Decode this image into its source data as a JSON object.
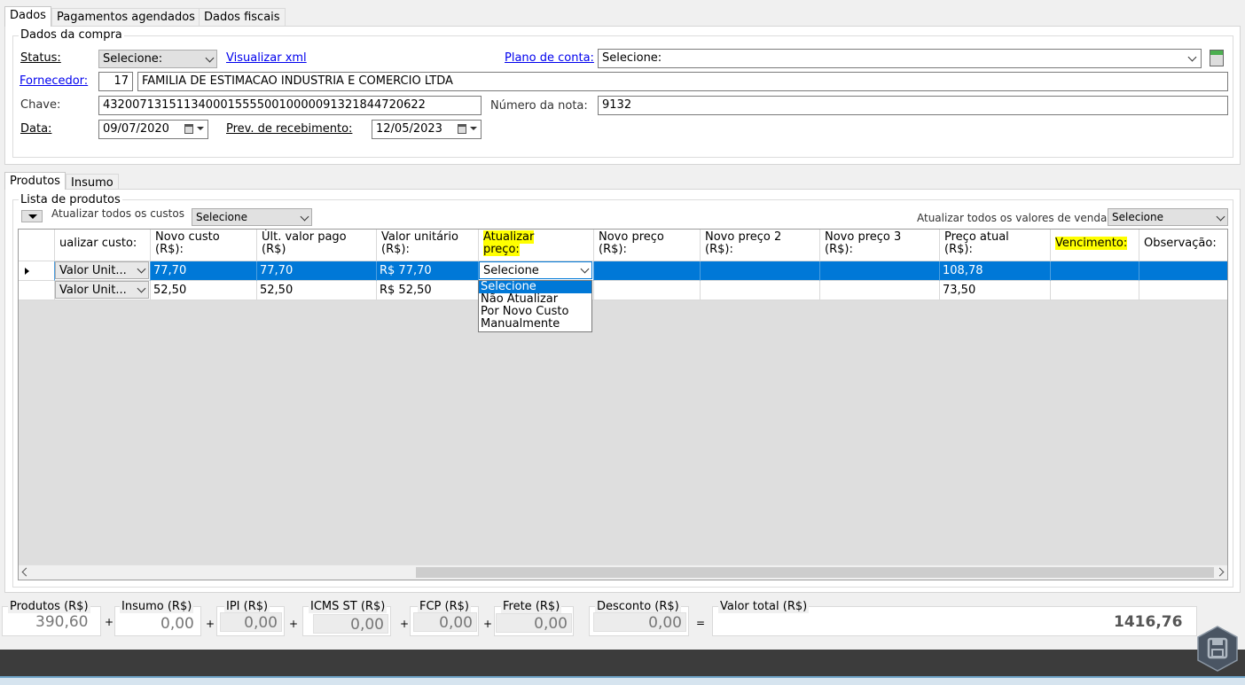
{
  "tabs": [
    "Dados",
    "Pagamentos agendados",
    "Dados fiscais"
  ],
  "purchase": {
    "legend": "Dados da compra",
    "status_label": "Status:",
    "status_value": "Selecione:",
    "xml_link": "Visualizar xml",
    "plan_label": "Plano de conta:",
    "plan_value": "Selecione:",
    "supplier_label": "Fornecedor:",
    "supplier_code": "17",
    "supplier_name": "FAMILIA DE ESTIMACAO INDUSTRIA E COMERCIO LTDA",
    "key_label": "Chave:",
    "key_value": "43200713151134000155550010000091321844720622",
    "note_label": "Número da nota:",
    "note_value": "9132",
    "date_label": "Data:",
    "date_value": "09/07/2020",
    "receive_label": "Prev. de recebimento:",
    "receive_value": "12/05/2023"
  },
  "subtabs": [
    "Produtos",
    "Insumo"
  ],
  "products": {
    "legend": "Lista de produtos",
    "update_costs_label": "Atualizar todos os custos",
    "update_costs_value": "Selecione",
    "update_sales_label": "Atualizar todos os valores de venda",
    "update_sales_value": "Selecione",
    "columns": [
      {
        "l1": "ualizar custo:",
        "l2": ""
      },
      {
        "l1": "Novo custo",
        "l2": "(R$):"
      },
      {
        "l1": "Últ. valor pago",
        "l2": "(R$)"
      },
      {
        "l1": "Valor unitário",
        "l2": "(R$):"
      },
      {
        "l1": "Atualizar",
        "l2": "preço:"
      },
      {
        "l1": "Novo preço",
        "l2": "(R$):"
      },
      {
        "l1": "Novo preço 2",
        "l2": "(R$):"
      },
      {
        "l1": "Novo preço 3",
        "l2": "(R$):"
      },
      {
        "l1": "Preço atual",
        "l2": "(R$):"
      },
      {
        "l1": "Vencimento:",
        "l2": ""
      },
      {
        "l1": "Observação:",
        "l2": ""
      }
    ],
    "rows": [
      {
        "cost_mode": "Valor Unit...",
        "new_cost": "77,70",
        "last_paid": "77,70",
        "unit": "R$ 77,70",
        "update_price": "Selecione",
        "p1": "",
        "p2": "",
        "p3": "",
        "current": "108,78",
        "due": "",
        "obs": ""
      },
      {
        "cost_mode": "Valor Unit...",
        "new_cost": "52,50",
        "last_paid": "52,50",
        "unit": "R$ 52,50",
        "update_price": "",
        "p1": "",
        "p2": "",
        "p3": "",
        "current": "73,50",
        "due": "",
        "obs": ""
      }
    ],
    "dropdown_options": [
      "Selecione",
      "Não Atualizar",
      "Por Novo Custo",
      "Manualmente"
    ]
  },
  "totals": {
    "products_label": "Produtos (R$)",
    "products_value": "390,60",
    "insumo_label": "Insumo (R$)",
    "insumo_value": "0,00",
    "ipi_label": "IPI (R$)",
    "ipi_value": "0,00",
    "icms_label": "ICMS ST (R$)",
    "icms_value": "0,00",
    "fcp_label": "FCP (R$)",
    "fcp_value": "0,00",
    "freight_label": "Frete (R$)",
    "freight_value": "0,00",
    "discount_label": "Desconto (R$)",
    "discount_value": "0,00",
    "total_label": "Valor total (R$)",
    "total_value": "1416,76",
    "plus": "+",
    "equals": "="
  },
  "colors": {
    "selection": "#0078d7",
    "highlight": "#ffff00",
    "footer": "#3c3c3c"
  }
}
